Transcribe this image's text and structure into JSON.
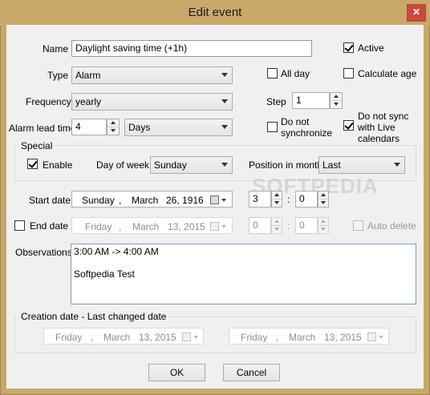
{
  "window": {
    "title": "Edit event",
    "close_glyph": "✕"
  },
  "colors": {
    "title_bar": "#c9a96a",
    "close_button": "#c74b3a",
    "client_bg": "#f0f0f0",
    "focus_border": "#7a9cc6"
  },
  "form": {
    "name_label": "Name",
    "name_value": "Daylight saving time (+1h)",
    "active_label": "Active",
    "active_checked": true,
    "type_label": "Type",
    "type_value": "Alarm",
    "all_day_label": "All day",
    "all_day_checked": false,
    "calculate_age_label": "Calculate age",
    "calculate_age_checked": false,
    "frequency_label": "Frequency",
    "frequency_value": "yearly",
    "step_label": "Step",
    "step_value": "1",
    "alarm_lead_label": "Alarm lead time",
    "alarm_lead_value": "4",
    "alarm_lead_unit": "Days",
    "no_sync_label_1": "Do not",
    "no_sync_label_2": "synchronize",
    "no_sync_checked": false,
    "no_sync_live_label_1": "Do not sync",
    "no_sync_live_label_2": "with Live",
    "no_sync_live_label_3": "calendars",
    "no_sync_live_checked": true
  },
  "special": {
    "group_title": "Special",
    "enable_label": "Enable",
    "enable_checked": true,
    "day_of_week_label": "Day of week",
    "day_of_week_value": "Sunday",
    "position_label": "Position in month",
    "position_value": "Last"
  },
  "dates": {
    "start_label": "Start date",
    "start_weekday": "Sunday",
    "start_month": "March",
    "start_day_year": "26, 1916",
    "start_hour": "3",
    "start_minute": "0",
    "end_label": "End date",
    "end_checked": false,
    "end_weekday": "Friday",
    "end_month": "March",
    "end_day_year": "13, 2015",
    "end_hour": "0",
    "end_minute": "0",
    "auto_delete_label": "Auto delete",
    "auto_delete_checked": false,
    "time_separator": ":",
    "comma": ","
  },
  "observations": {
    "label": "Observations",
    "text": "3:00 AM -> 4:00 AM\n\nSoftpedia Test"
  },
  "creation": {
    "group_title": "Creation date - Last changed date",
    "created_weekday": "Friday",
    "created_month": "March",
    "created_day_year": "13, 2015",
    "changed_weekday": "Friday",
    "changed_month": "March",
    "changed_day_year": "13, 2015"
  },
  "buttons": {
    "ok_label": "OK",
    "cancel_label": "Cancel"
  },
  "watermark": "SOFTPEDIA"
}
